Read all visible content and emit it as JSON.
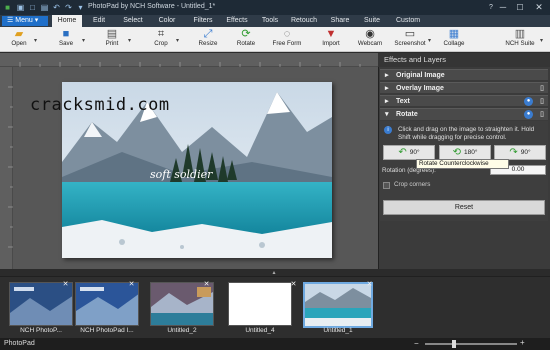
{
  "window": {
    "title": "PhotoPad by NCH Software - Untitled_1*"
  },
  "window_controls": {
    "minimize": "─",
    "maximize": "☐",
    "close": "✕"
  },
  "menubar": {
    "menu_label": "Menu",
    "tabs": [
      "Home",
      "Edit",
      "Select",
      "Color",
      "Filters",
      "Effects",
      "Tools",
      "Retouch",
      "Share",
      "Suite",
      "Custom"
    ],
    "active_tab": "Home"
  },
  "toolbar": {
    "open": "Open",
    "save": "Save",
    "print": "Print",
    "crop": "Crop",
    "resize": "Resize",
    "rotate": "Rotate",
    "free_form": "Free Form",
    "import": "Import",
    "webcam": "Webcam",
    "screenshot": "Screenshot",
    "collage": "Collage",
    "nch_suite": "NCH Suite"
  },
  "canvas": {
    "watermark": "cracksmid.com",
    "overlay_text": "soft soldier"
  },
  "panel": {
    "title": "Effects and Layers",
    "sections": {
      "original_image": "Original Image",
      "overlay_image": "Overlay Image",
      "text": "Text",
      "rotate": "Rotate"
    },
    "rotate": {
      "hint": "Click and drag on the image to straighten it. Hold Shift while dragging for precise control.",
      "btn_ccw": "90°",
      "btn_180": "180°",
      "btn_cw": "90°",
      "tooltip": "Rotate Counterclockwise",
      "rotation_label": "Rotation (degrees):",
      "rotation_value": "0.00",
      "crop_corners": "Crop corners",
      "reset": "Reset"
    }
  },
  "filmstrip": {
    "items": [
      {
        "label": "NCH PhotoP..."
      },
      {
        "label": "NCH PhotoPad I..."
      },
      {
        "label": "Untitled_2"
      },
      {
        "label": "Untitled_4"
      },
      {
        "label": "Untitled_1"
      }
    ],
    "selected_index": 4
  },
  "status": {
    "app_name": "PhotoPad",
    "zoom_minus": "−",
    "zoom_plus": "+"
  },
  "colors": {
    "accent": "#1f6fc9",
    "title_bg": "#1e2a36",
    "panel_bg": "#3b3b3b"
  }
}
